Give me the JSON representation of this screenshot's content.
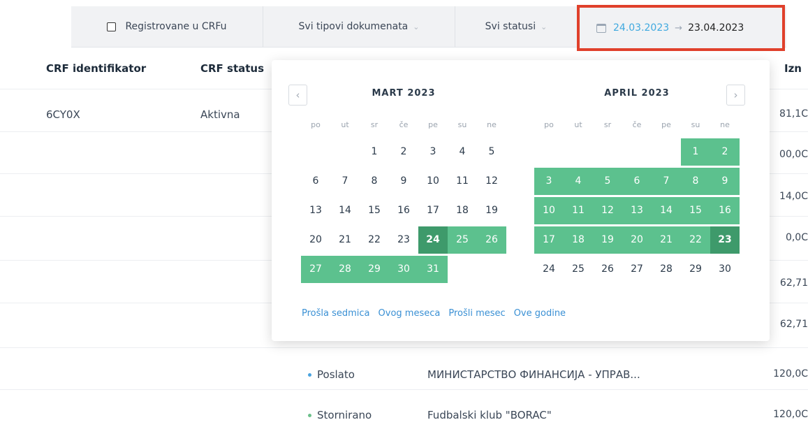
{
  "filters": {
    "registered_label": "Registrovane u CRFu",
    "doc_types_label": "Svi tipovi dokumenata",
    "statuses_label": "Svi statusi",
    "date_start": "24.03.2023",
    "date_end": "23.04.2023",
    "caret": "⌄",
    "arrow": "→"
  },
  "table": {
    "headers": {
      "crf_id": "CRF identifikator",
      "crf_status": "CRF status",
      "amount": "Izn"
    },
    "rows": [
      {
        "crf_id": "6CY0X",
        "crf_status": "Aktivna",
        "status": "",
        "partner": "",
        "amount": "81,1C"
      },
      {
        "crf_id": "",
        "crf_status": "",
        "status": "",
        "partner": "",
        "amount": "00,0C"
      },
      {
        "crf_id": "",
        "crf_status": "",
        "status": "",
        "partner": "",
        "amount": "14,0C"
      },
      {
        "crf_id": "",
        "crf_status": "",
        "status": "",
        "partner": "",
        "amount": "0,0C"
      },
      {
        "crf_id": "",
        "crf_status": "",
        "status": "",
        "partner": "",
        "amount": "62,71"
      },
      {
        "crf_id": "",
        "crf_status": "",
        "status": "",
        "partner": "",
        "amount": "62,71"
      },
      {
        "crf_id": "",
        "crf_status": "",
        "status": "Poslato",
        "partner": "МИНИСТАРСТВО ФИНАНСИЈА - УПРАВ...",
        "amount": "120,0C"
      },
      {
        "crf_id": "",
        "crf_status": "",
        "status": "Stornirano",
        "partner": "Fudbalski klub \"BORAC\"",
        "amount": "120,0C"
      }
    ]
  },
  "calendar": {
    "prev_icon": "‹",
    "next_icon": "›",
    "weekdays": [
      "po",
      "ut",
      "sr",
      "če",
      "pe",
      "su",
      "ne"
    ],
    "left_month": {
      "title": "MART 2023",
      "first_weekday": 2,
      "days_in_month": 31,
      "range_start": 24,
      "range_end": 31
    },
    "right_month": {
      "title": "APRIL 2023",
      "first_weekday": 5,
      "days_in_month": 30,
      "range_start": 1,
      "range_end": 23
    },
    "presets": [
      "Prošla sedmica",
      "Ovog meseca",
      "Prošli mesec",
      "Ove godine"
    ]
  },
  "colors": {
    "range_fill": "#5cc18e",
    "range_edge": "#3e9a6b",
    "highlight_border": "#e0402b",
    "link": "#3a90d4"
  }
}
